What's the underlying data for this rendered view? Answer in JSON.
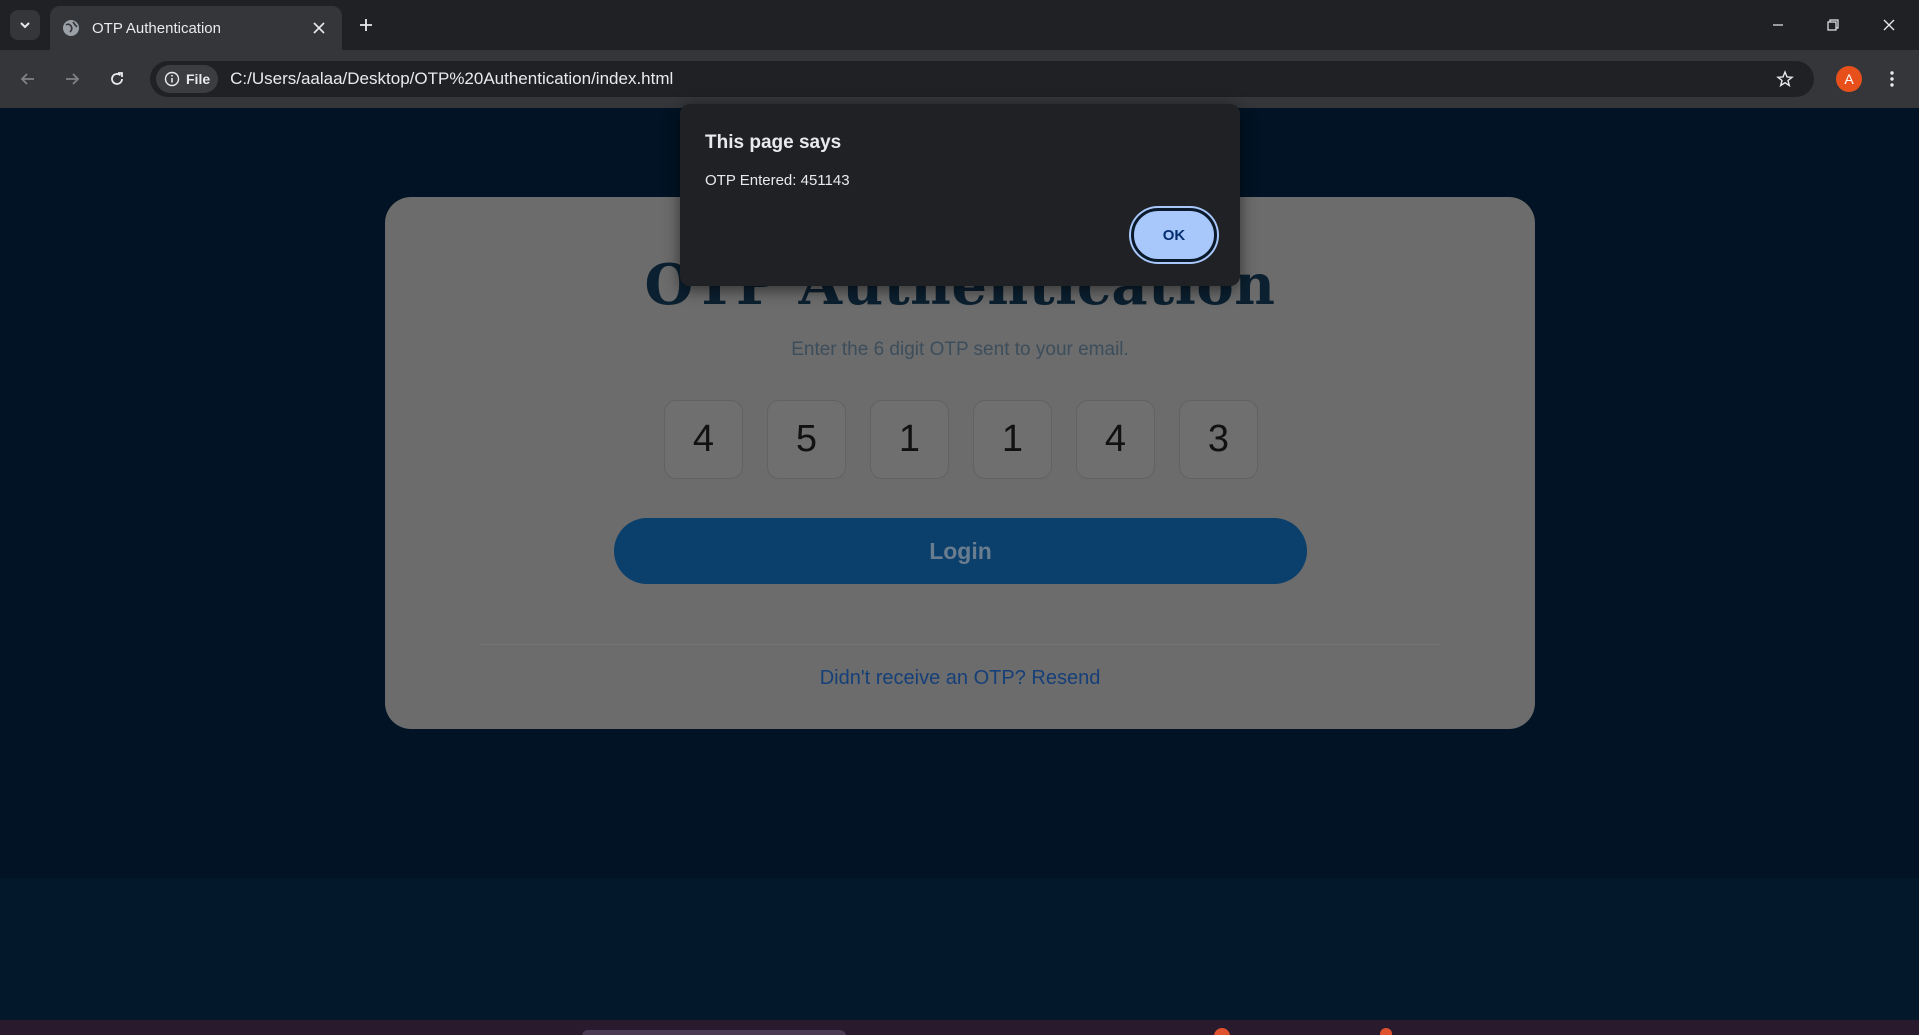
{
  "browser": {
    "tab_title": "OTP Authentication",
    "chip_label": "File",
    "url": "C:/Users/aalaa/Desktop/OTP%20Authentication/index.html",
    "profile_initial": "A"
  },
  "page": {
    "title": "OTP Authentication",
    "subtitle": "Enter the 6 digit OTP sent to your email.",
    "otp_digits": [
      "4",
      "5",
      "1",
      "1",
      "4",
      "3"
    ],
    "login_label": "Login",
    "resend_text": "Didn't receive an OTP? Resend"
  },
  "dialog": {
    "title": "This page says",
    "message": "OTP Entered: 451143",
    "ok_label": "OK"
  },
  "colors": {
    "page_background": "#011324",
    "card": "#6c6c6c",
    "login_button": "#0b3f6c",
    "dialog_ok": "#a8c7fa"
  }
}
